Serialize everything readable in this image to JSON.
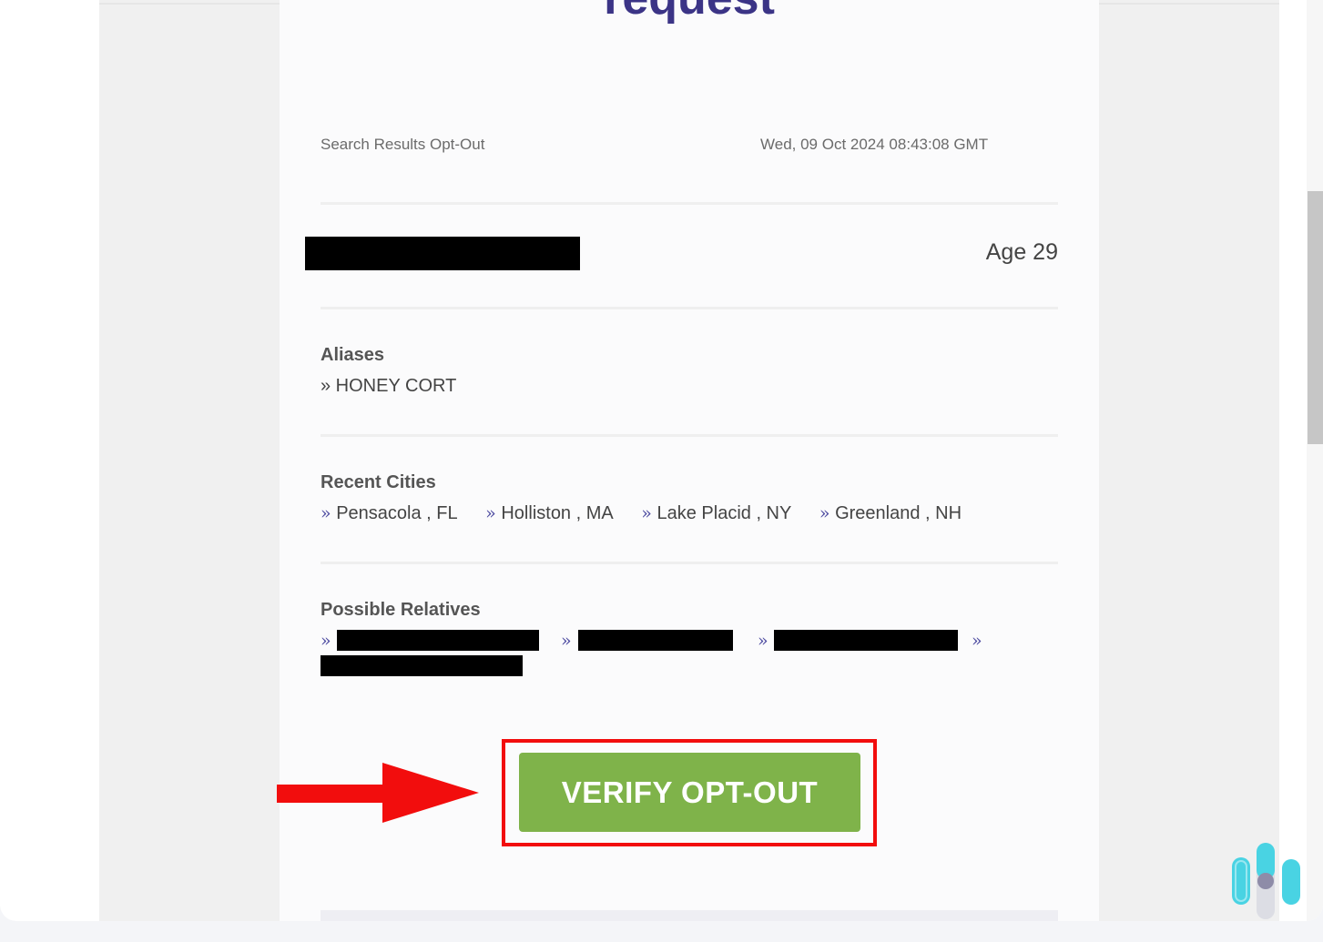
{
  "page": {
    "heading": "request"
  },
  "meta": {
    "type": "Search Results Opt-Out",
    "timestamp": "Wed, 09 Oct 2024 08:43:08 GMT"
  },
  "person": {
    "age": "Age 29"
  },
  "aliases": {
    "title": "Aliases",
    "items": [
      "» HONEY CORT"
    ]
  },
  "recent_cities": {
    "title": "Recent Cities",
    "items": [
      "Pensacola , FL",
      "Holliston , MA",
      "Lake Placid , NY",
      "Greenland , NH"
    ]
  },
  "relatives": {
    "title": "Possible Relatives",
    "separator": "»"
  },
  "action": {
    "verify_label": "VERIFY OPT-OUT"
  },
  "colors": {
    "heading": "#3b3486",
    "button": "#7fb34a",
    "highlight_frame": "#f20d0d",
    "arrow": "#f20d0d"
  },
  "icons": {
    "annotation": "red-arrow-right",
    "brand": "equalizer-logo"
  }
}
